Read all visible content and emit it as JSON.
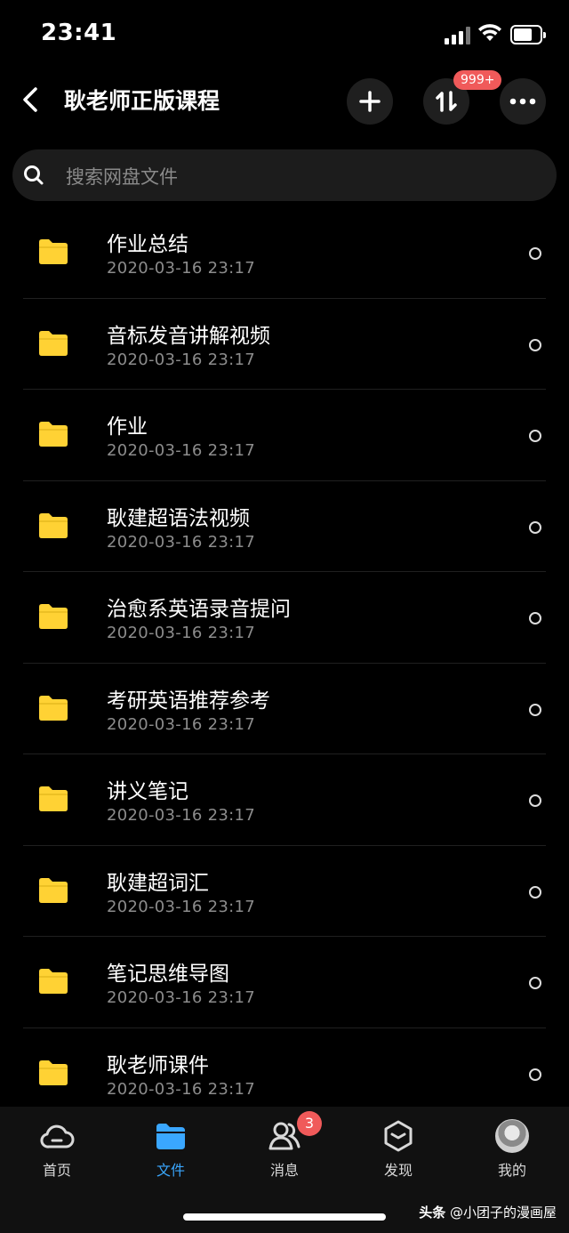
{
  "status_bar": {
    "time": "23:41"
  },
  "header": {
    "title": "耿老师正版课程",
    "transfer_badge": "999+"
  },
  "search": {
    "placeholder": "搜索网盘文件"
  },
  "files": [
    {
      "name": "作业总结",
      "date": "2020-03-16 23:17"
    },
    {
      "name": "音标发音讲解视频",
      "date": "2020-03-16 23:17"
    },
    {
      "name": "作业",
      "date": "2020-03-16 23:17"
    },
    {
      "name": "耿建超语法视频",
      "date": "2020-03-16 23:17"
    },
    {
      "name": "治愈系英语录音提问",
      "date": "2020-03-16 23:17"
    },
    {
      "name": "考研英语推荐参考",
      "date": "2020-03-16 23:17"
    },
    {
      "name": "讲义笔记",
      "date": "2020-03-16 23:17"
    },
    {
      "name": "耿建超词汇",
      "date": "2020-03-16 23:17"
    },
    {
      "name": "笔记思维导图",
      "date": "2020-03-16 23:17"
    },
    {
      "name": "耿老师课件",
      "date": "2020-03-16 23:17"
    }
  ],
  "tabbar": {
    "tabs": [
      {
        "label": "首页",
        "icon": "cloud-icon"
      },
      {
        "label": "文件",
        "icon": "folder-icon",
        "active": true
      },
      {
        "label": "消息",
        "icon": "people-icon",
        "badge": "3"
      },
      {
        "label": "发现",
        "icon": "cube-icon"
      },
      {
        "label": "我的",
        "icon": "avatar"
      }
    ]
  },
  "watermark": {
    "brand": "头条",
    "handle": "@小团子的漫画屋"
  },
  "colors": {
    "accent": "#3aa7ff",
    "folder": "#ffd234",
    "badge": "#f05a5a"
  }
}
